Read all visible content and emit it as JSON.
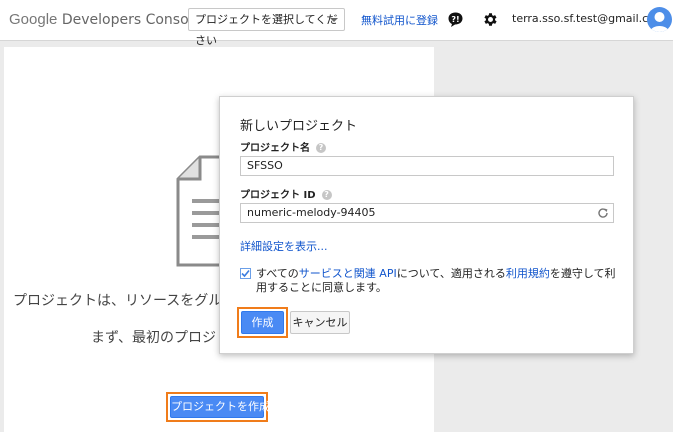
{
  "header": {
    "logo_google": "Google",
    "logo_product": "Developers Console",
    "project_select": "プロジェクトを選択してください",
    "trial_link": "無料試用に登録",
    "email": "terra.sso.sf.test@gmail.com"
  },
  "main": {
    "intro_line1": "プロジェクトは、リソースをグルー",
    "intro_line2": "まず、最初のプロジ",
    "create_project_button": "プロジェクトを作成"
  },
  "dialog": {
    "title": "新しいプロジェクト",
    "project_name_label": "プロジェクト名",
    "project_name_value": "SFSSO",
    "project_id_label": "プロジェクト ID",
    "project_id_value": "numeric-melody-94405",
    "advanced_link": "詳細設定を表示...",
    "agree_pre": "すべての",
    "agree_link1": "サービスと関連 API",
    "agree_mid": "について、適用される",
    "agree_link2": "利用規約",
    "agree_post": "を遵守して利用することに同意します。",
    "agree_checked": true,
    "create_button": "作成",
    "cancel_button": "キャンセル",
    "help_glyph": "?"
  },
  "colors": {
    "accent_blue": "#4a8af4",
    "link_blue": "#1155cc",
    "highlight_orange": "#f07c1a"
  },
  "icons": [
    "feedback-icon",
    "gear-icon",
    "avatar",
    "help-icon",
    "refresh-icon",
    "document-icon",
    "checkbox-checked"
  ]
}
